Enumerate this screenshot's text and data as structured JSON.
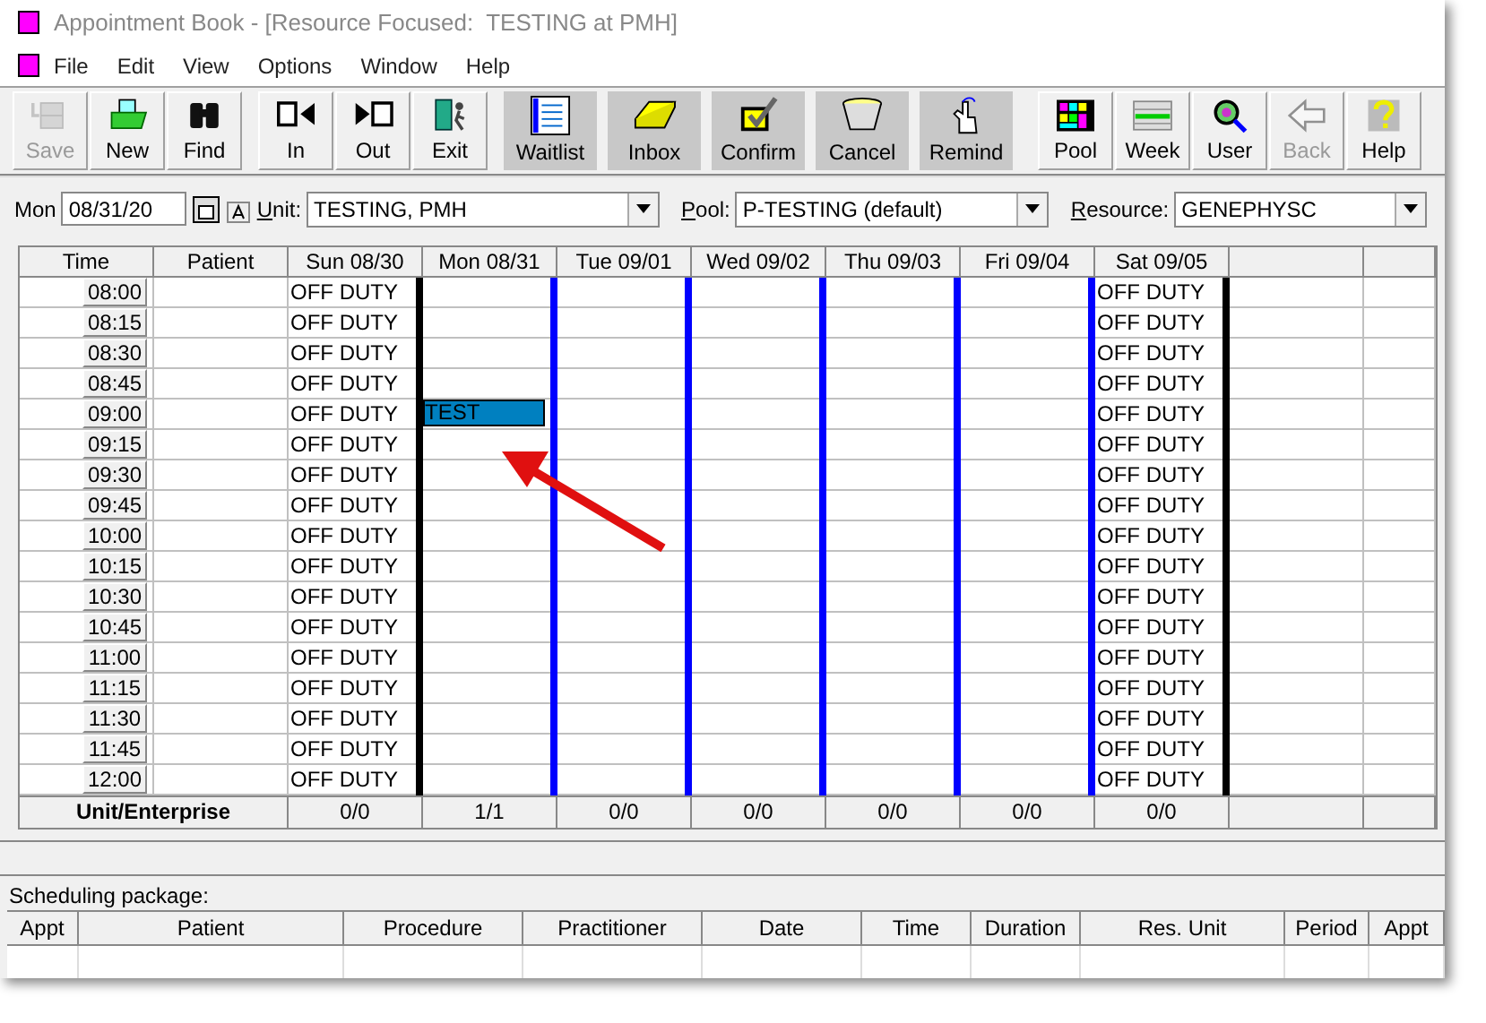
{
  "window": {
    "title": "Appointment Book - [Resource Focused:  TESTING at PMH]"
  },
  "menu": [
    "File",
    "Edit",
    "View",
    "Options",
    "Window",
    "Help"
  ],
  "toolbar": [
    {
      "label": "Save",
      "kind": "raised",
      "disabled": true,
      "gap_before": false
    },
    {
      "label": "New",
      "kind": "raised",
      "disabled": false,
      "gap_before": false
    },
    {
      "label": "Find",
      "kind": "raised",
      "disabled": false,
      "gap_before": false
    },
    {
      "label": "In",
      "kind": "raised",
      "disabled": false,
      "gap_before": true
    },
    {
      "label": "Out",
      "kind": "raised",
      "disabled": false,
      "gap_before": false
    },
    {
      "label": "Exit",
      "kind": "raised",
      "disabled": false,
      "gap_before": false
    },
    {
      "label": "Waitlist",
      "kind": "flat",
      "disabled": false,
      "gap_before": true
    },
    {
      "label": "Inbox",
      "kind": "flat",
      "disabled": false,
      "gap_before": false
    },
    {
      "label": "Confirm",
      "kind": "flat",
      "disabled": false,
      "gap_before": false
    },
    {
      "label": "Cancel",
      "kind": "flat",
      "disabled": false,
      "gap_before": false
    },
    {
      "label": "Remind",
      "kind": "flat",
      "disabled": false,
      "gap_before": false
    },
    {
      "label": "Pool",
      "kind": "raised",
      "disabled": false,
      "gap_before": true
    },
    {
      "label": "Week",
      "kind": "raised",
      "disabled": false,
      "gap_before": false
    },
    {
      "label": "User",
      "kind": "raised",
      "disabled": false,
      "gap_before": false
    },
    {
      "label": "Back",
      "kind": "raised",
      "disabled": true,
      "gap_before": false
    },
    {
      "label": "Help",
      "kind": "raised",
      "disabled": false,
      "gap_before": false
    }
  ],
  "filters": {
    "day_label": "Mon",
    "date": "08/31/20",
    "unit_label": "Unit:",
    "unit": "TESTING, PMH",
    "pool_label": "Pool:",
    "pool": "P-TESTING (default)",
    "resource_label": "Resource:",
    "resource": "GENEPHYSC"
  },
  "grid": {
    "time_header": "Time",
    "patient_header": "Patient",
    "days": [
      {
        "label": "Sun 08/30",
        "color": "#000000",
        "total": "0/0"
      },
      {
        "label": "Mon 08/31",
        "color": "#0000ff",
        "total": "1/1"
      },
      {
        "label": "Tue 09/01",
        "color": "#0000ff",
        "total": "0/0"
      },
      {
        "label": "Wed 09/02",
        "color": "#0000ff",
        "total": "0/0"
      },
      {
        "label": "Thu 09/03",
        "color": "#0000ff",
        "total": "0/0"
      },
      {
        "label": "Fri 09/04",
        "color": "#0000ff",
        "total": "0/0"
      },
      {
        "label": "Sat 09/05",
        "color": "#000000",
        "total": "0/0"
      }
    ],
    "rows": [
      {
        "time": "08:00",
        "cells": [
          {
            "kind": "off_duty",
            "text": "OFF DUTY"
          },
          {
            "kind": "empty"
          },
          {
            "kind": "empty"
          },
          {
            "kind": "empty"
          },
          {
            "kind": "empty"
          },
          {
            "kind": "empty"
          },
          {
            "kind": "off_duty",
            "text": "OFF DUTY"
          }
        ]
      },
      {
        "time": "08:15",
        "cells": [
          {
            "kind": "off_duty",
            "text": "OFF DUTY"
          },
          {
            "kind": "empty"
          },
          {
            "kind": "empty"
          },
          {
            "kind": "empty"
          },
          {
            "kind": "empty"
          },
          {
            "kind": "empty"
          },
          {
            "kind": "off_duty",
            "text": "OFF DUTY"
          }
        ]
      },
      {
        "time": "08:30",
        "cells": [
          {
            "kind": "off_duty",
            "text": "OFF DUTY"
          },
          {
            "kind": "empty"
          },
          {
            "kind": "empty"
          },
          {
            "kind": "empty"
          },
          {
            "kind": "empty"
          },
          {
            "kind": "empty"
          },
          {
            "kind": "off_duty",
            "text": "OFF DUTY"
          }
        ]
      },
      {
        "time": "08:45",
        "cells": [
          {
            "kind": "off_duty",
            "text": "OFF DUTY"
          },
          {
            "kind": "empty"
          },
          {
            "kind": "empty"
          },
          {
            "kind": "empty"
          },
          {
            "kind": "empty"
          },
          {
            "kind": "empty"
          },
          {
            "kind": "off_duty",
            "text": "OFF DUTY"
          }
        ]
      },
      {
        "time": "09:00",
        "cells": [
          {
            "kind": "off_duty",
            "text": "OFF DUTY"
          },
          {
            "kind": "appointment",
            "text": "TEST"
          },
          {
            "kind": "empty"
          },
          {
            "kind": "empty"
          },
          {
            "kind": "empty"
          },
          {
            "kind": "empty"
          },
          {
            "kind": "off_duty",
            "text": "OFF DUTY"
          }
        ]
      },
      {
        "time": "09:15",
        "cells": [
          {
            "kind": "off_duty",
            "text": "OFF DUTY"
          },
          {
            "kind": "empty"
          },
          {
            "kind": "empty"
          },
          {
            "kind": "empty"
          },
          {
            "kind": "empty"
          },
          {
            "kind": "empty"
          },
          {
            "kind": "off_duty",
            "text": "OFF DUTY"
          }
        ]
      },
      {
        "time": "09:30",
        "cells": [
          {
            "kind": "off_duty",
            "text": "OFF DUTY"
          },
          {
            "kind": "empty"
          },
          {
            "kind": "empty"
          },
          {
            "kind": "empty"
          },
          {
            "kind": "empty"
          },
          {
            "kind": "empty"
          },
          {
            "kind": "off_duty",
            "text": "OFF DUTY"
          }
        ]
      },
      {
        "time": "09:45",
        "cells": [
          {
            "kind": "off_duty",
            "text": "OFF DUTY"
          },
          {
            "kind": "empty"
          },
          {
            "kind": "empty"
          },
          {
            "kind": "empty"
          },
          {
            "kind": "empty"
          },
          {
            "kind": "empty"
          },
          {
            "kind": "off_duty",
            "text": "OFF DUTY"
          }
        ]
      },
      {
        "time": "10:00",
        "cells": [
          {
            "kind": "off_duty",
            "text": "OFF DUTY"
          },
          {
            "kind": "empty"
          },
          {
            "kind": "empty"
          },
          {
            "kind": "empty"
          },
          {
            "kind": "empty"
          },
          {
            "kind": "empty"
          },
          {
            "kind": "off_duty",
            "text": "OFF DUTY"
          }
        ]
      },
      {
        "time": "10:15",
        "cells": [
          {
            "kind": "off_duty",
            "text": "OFF DUTY"
          },
          {
            "kind": "empty"
          },
          {
            "kind": "empty"
          },
          {
            "kind": "empty"
          },
          {
            "kind": "empty"
          },
          {
            "kind": "empty"
          },
          {
            "kind": "off_duty",
            "text": "OFF DUTY"
          }
        ]
      },
      {
        "time": "10:30",
        "cells": [
          {
            "kind": "off_duty",
            "text": "OFF DUTY"
          },
          {
            "kind": "empty"
          },
          {
            "kind": "empty"
          },
          {
            "kind": "empty"
          },
          {
            "kind": "empty"
          },
          {
            "kind": "empty"
          },
          {
            "kind": "off_duty",
            "text": "OFF DUTY"
          }
        ]
      },
      {
        "time": "10:45",
        "cells": [
          {
            "kind": "off_duty",
            "text": "OFF DUTY"
          },
          {
            "kind": "empty"
          },
          {
            "kind": "empty"
          },
          {
            "kind": "empty"
          },
          {
            "kind": "empty"
          },
          {
            "kind": "empty"
          },
          {
            "kind": "off_duty",
            "text": "OFF DUTY"
          }
        ]
      },
      {
        "time": "11:00",
        "cells": [
          {
            "kind": "off_duty",
            "text": "OFF DUTY"
          },
          {
            "kind": "empty"
          },
          {
            "kind": "empty"
          },
          {
            "kind": "empty"
          },
          {
            "kind": "empty"
          },
          {
            "kind": "empty"
          },
          {
            "kind": "off_duty",
            "text": "OFF DUTY"
          }
        ]
      },
      {
        "time": "11:15",
        "cells": [
          {
            "kind": "off_duty",
            "text": "OFF DUTY"
          },
          {
            "kind": "empty"
          },
          {
            "kind": "empty"
          },
          {
            "kind": "empty"
          },
          {
            "kind": "empty"
          },
          {
            "kind": "empty"
          },
          {
            "kind": "off_duty",
            "text": "OFF DUTY"
          }
        ]
      },
      {
        "time": "11:30",
        "cells": [
          {
            "kind": "off_duty",
            "text": "OFF DUTY"
          },
          {
            "kind": "empty"
          },
          {
            "kind": "empty"
          },
          {
            "kind": "empty"
          },
          {
            "kind": "empty"
          },
          {
            "kind": "empty"
          },
          {
            "kind": "off_duty",
            "text": "OFF DUTY"
          }
        ]
      },
      {
        "time": "11:45",
        "cells": [
          {
            "kind": "off_duty",
            "text": "OFF DUTY"
          },
          {
            "kind": "empty"
          },
          {
            "kind": "empty"
          },
          {
            "kind": "empty"
          },
          {
            "kind": "empty"
          },
          {
            "kind": "empty"
          },
          {
            "kind": "off_duty",
            "text": "OFF DUTY"
          }
        ]
      },
      {
        "time": "12:00",
        "cells": [
          {
            "kind": "off_duty",
            "text": "OFF DUTY"
          },
          {
            "kind": "empty"
          },
          {
            "kind": "empty"
          },
          {
            "kind": "empty"
          },
          {
            "kind": "empty"
          },
          {
            "kind": "empty"
          },
          {
            "kind": "off_duty",
            "text": "OFF DUTY"
          }
        ]
      }
    ],
    "footer_label": "Unit/Enterprise"
  },
  "scheduling_package": {
    "label": "Scheduling package:",
    "columns": [
      "Appt",
      "Patient",
      "Procedure",
      "Practitioner",
      "Date",
      "Time",
      "Duration",
      "Res. Unit",
      "Period",
      "Appt"
    ]
  }
}
